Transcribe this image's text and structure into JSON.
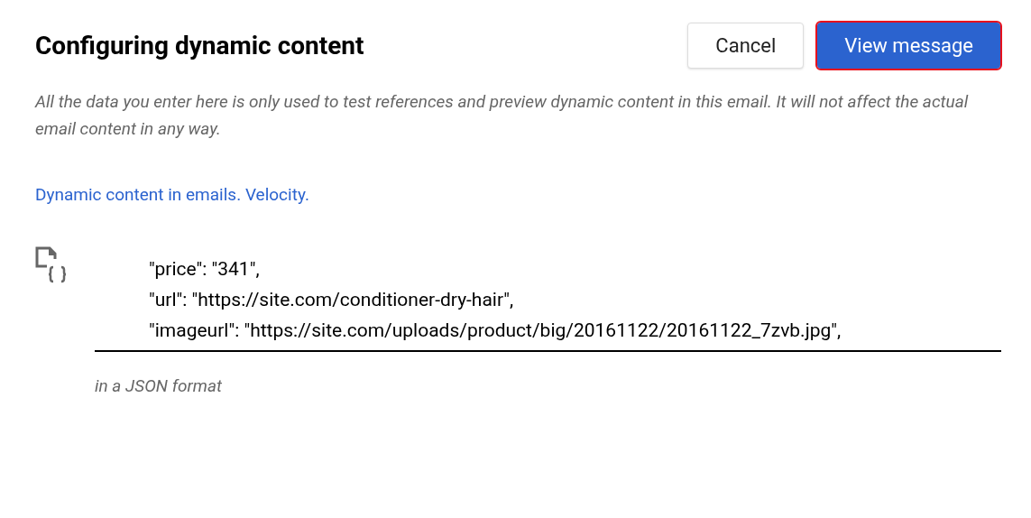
{
  "dialog": {
    "title": "Configuring dynamic content",
    "buttons": [
      {
        "label": "Cancel",
        "kind": "secondary",
        "highlighted": false
      },
      {
        "label": "View message",
        "kind": "primary",
        "highlighted": true
      }
    ],
    "description": "All the data you enter here is only used to test references and preview dynamic content in this email. It will not affect the actual email content in any way.",
    "link": "Dynamic content in emails. Velocity.",
    "json_field": {
      "lines": [
        "\"price\": \"341\",",
        "\"url\": \"https://site.com/conditioner-dry-hair\",",
        "\"imageurl\": \"https://site.com/uploads/product/big/20161122/20161122_7zvb.jpg\","
      ],
      "helper": "in a JSON format"
    }
  }
}
